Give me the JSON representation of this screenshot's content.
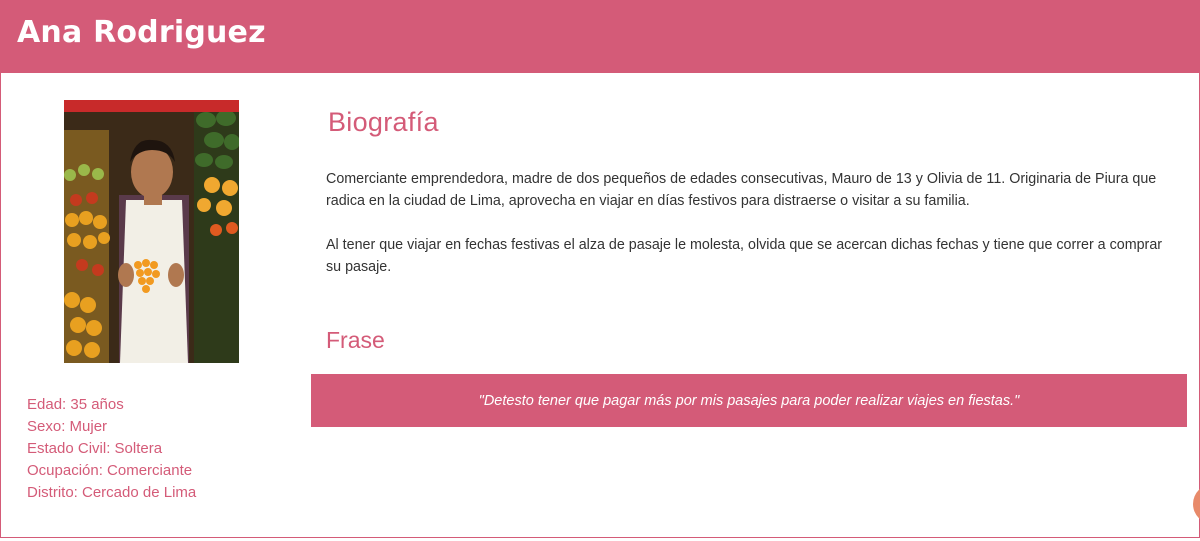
{
  "header": {
    "name": "Ana Rodriguez"
  },
  "profile": {
    "photo_alt": "Fruit vendor woman",
    "details": [
      "Edad: 35 años",
      "Sexo: Mujer",
      "Estado Civil: Soltera",
      "Ocupación: Comerciante",
      "Distrito: Cercado de Lima"
    ]
  },
  "biography": {
    "title": "Biografía",
    "paragraphs": [
      "Comerciante emprendedora, madre de dos pequeños de edades consecutivas, Mauro de 13 y Olivia de 11. Originaria de Piura que radica en la ciudad de Lima, aprovecha en viajar en días festivos para distraerse o visitar a su familia.",
      "Al tener que viajar en fechas festivas el alza de pasaje le molesta, olvida que se acercan dichas fechas y tiene que correr a comprar su pasaje."
    ]
  },
  "phrase": {
    "title": "Frase",
    "quote": "\"Detesto tener que pagar más por mis pasajes para poder realizar viajes en fiestas.\""
  },
  "colors": {
    "accent": "#d45b78",
    "text": "#333333",
    "chat_bubble": "#e88a6a"
  },
  "icons": {
    "chat": "chat-bubble-icon"
  }
}
